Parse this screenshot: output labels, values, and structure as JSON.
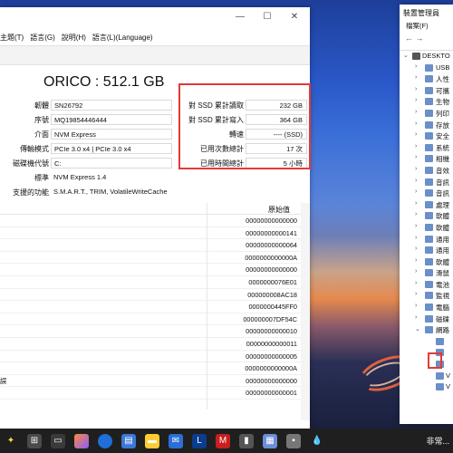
{
  "menu": [
    "主題(T)",
    "語言(G)",
    "說明(H)",
    "語言(L)(Language)"
  ],
  "disk": {
    "model": "ORICO : 512.1 GB",
    "left_fields": [
      {
        "label": "韌體",
        "value": "SN26792"
      },
      {
        "label": "序號",
        "value": "MQ19854446444"
      },
      {
        "label": "介面",
        "value": "NVM Express"
      },
      {
        "label": "傳輸模式",
        "value": "PCIe 3.0 x4 | PCIe 3.0 x4"
      },
      {
        "label": "磁碟機代號",
        "value": "C:"
      },
      {
        "label": "標準",
        "value": "NVM Express 1.4"
      },
      {
        "label": "支援的功能",
        "value": "S.M.A.R.T., TRIM, VolatileWriteCache"
      }
    ],
    "right_fields": [
      {
        "label": "對 SSD 累計讀取",
        "value": "232 GB"
      },
      {
        "label": "對 SSD 累計寫入",
        "value": "364 GB"
      },
      {
        "label": "轉速",
        "value": "---- (SSD)"
      },
      {
        "label": "已用次數總計",
        "value": "17 次"
      },
      {
        "label": "已用時間總計",
        "value": "5 小時"
      }
    ]
  },
  "table": {
    "header": "原始值",
    "rows": [
      {
        "name": "",
        "raw": "00000000000000"
      },
      {
        "name": "",
        "raw": "00000000000141"
      },
      {
        "name": "",
        "raw": "00000000000064"
      },
      {
        "name": "",
        "raw": "0000000000000A"
      },
      {
        "name": "",
        "raw": "00000000000000"
      },
      {
        "name": "",
        "raw": "0000000076E01"
      },
      {
        "name": "",
        "raw": "000000008AC18"
      },
      {
        "name": "",
        "raw": "0000000445FF0"
      },
      {
        "name": "",
        "raw": "000000007DF54C"
      },
      {
        "name": "",
        "raw": "00000000000010"
      },
      {
        "name": "",
        "raw": "00000000000011"
      },
      {
        "name": "",
        "raw": "00000000000005"
      },
      {
        "name": "",
        "raw": "0000000000000A"
      },
      {
        "name": "誤",
        "raw": "00000000000000"
      },
      {
        "name": "",
        "raw": "00000000000001"
      }
    ]
  },
  "device_manager": {
    "title": "裝置管理員",
    "menu": "檔案(F)",
    "root": "DESKTO",
    "items": [
      "USB",
      "人性",
      "可攜",
      "生物",
      "列印",
      "存放",
      "安全",
      "系統",
      "相機",
      "音效",
      "音訊",
      "音訊",
      "處理",
      "軟體",
      "軟體",
      "通用",
      "通用",
      "軟體",
      "滑鼠",
      "電池",
      "監視",
      "電腦",
      "磁碟",
      "網路"
    ],
    "sub_items": [
      "",
      "",
      "",
      "V",
      "V"
    ]
  },
  "taskbar": {
    "tray_text": "非常..."
  }
}
